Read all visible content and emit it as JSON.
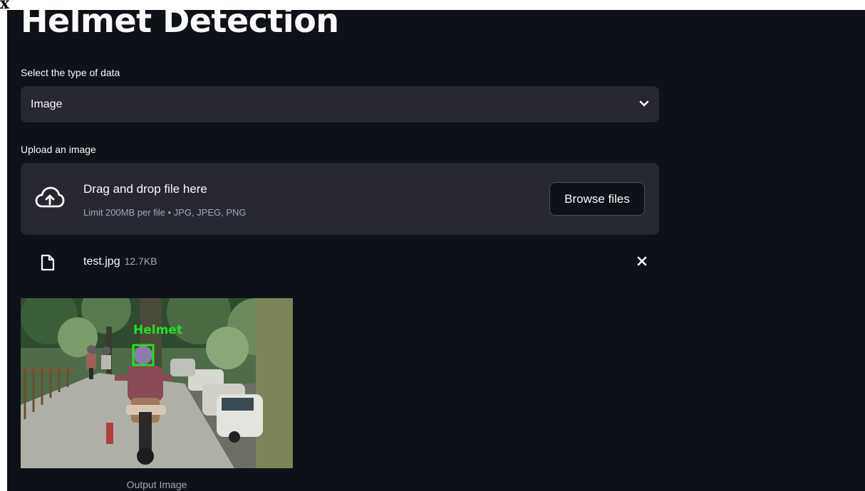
{
  "corner_mark": "x",
  "app": {
    "title": "Helmet Detection"
  },
  "data_type": {
    "label": "Select the type of data",
    "selected": "Image"
  },
  "uploader": {
    "label": "Upload an image",
    "drop_title": "Drag and drop file here",
    "limit_text": "Limit 200MB per file • JPG, JPEG, PNG",
    "browse_label": "Browse files"
  },
  "uploaded_file": {
    "name": "test.jpg",
    "size": "12.7KB"
  },
  "output": {
    "detection_label": "Helmet",
    "caption": "Output Image"
  },
  "colors": {
    "app_background": "#0e1117",
    "widget_background": "#262730",
    "detection_box": "#22e022",
    "muted_text": "#a3a8b8"
  },
  "icons": {
    "uploader": "cloud-upload-icon",
    "file": "file-icon",
    "remove": "close-icon",
    "select": "chevron-down-icon"
  }
}
